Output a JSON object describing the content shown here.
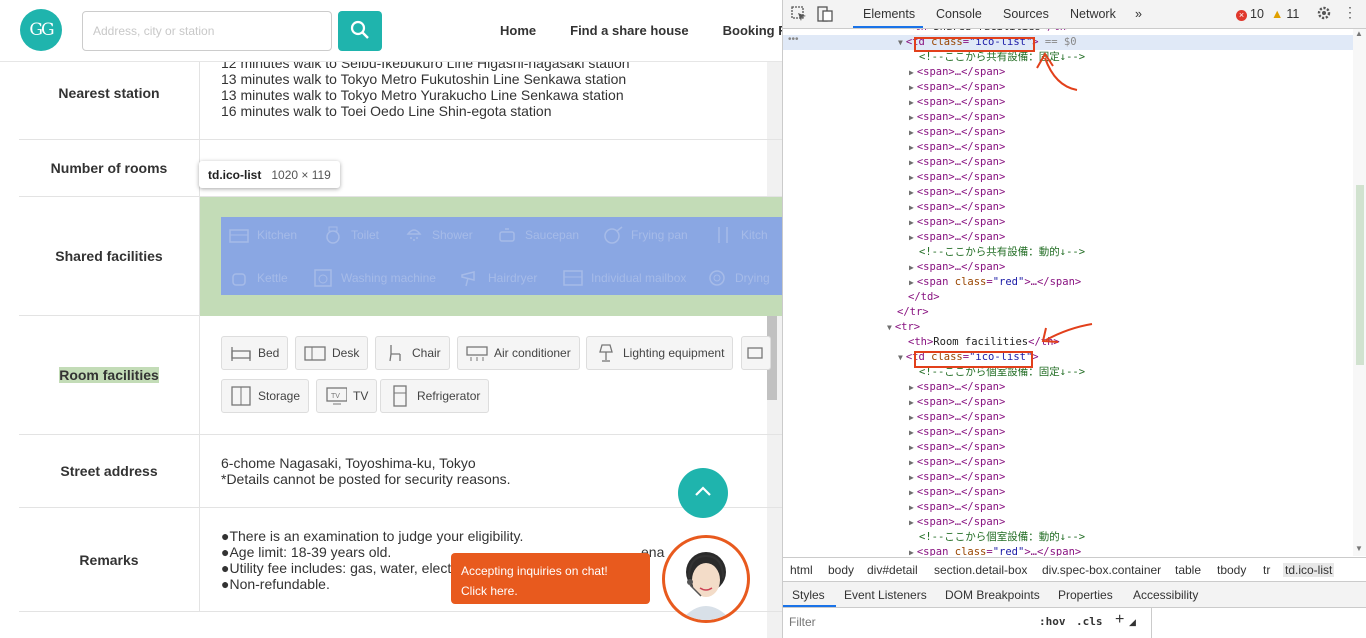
{
  "site": {
    "logo_text": "GG",
    "search_placeholder": "Address, city or station",
    "nav": [
      "Home",
      "Find a share house",
      "Booking F"
    ]
  },
  "spec": {
    "nearest_station": {
      "label": "Nearest station",
      "lines": [
        "12 minutes walk to Seibu-Ikebukuro Line Higashi-nagasaki station",
        "13 minutes walk to Tokyo Metro Fukutoshin Line Senkawa station",
        "13 minutes walk to Tokyo Metro Yurakucho Line Senkawa station",
        "16 minutes walk to Toei Oedo Line Shin-egota station"
      ]
    },
    "number_of_rooms": {
      "label": "Number of rooms"
    },
    "shared_facilities": {
      "label": "Shared facilities",
      "row1": [
        "Kitchen",
        "Toilet",
        "Shower",
        "Saucepan",
        "Frying pan",
        "Kitch"
      ],
      "row2": [
        "Kettle",
        "Washing machine",
        "Hairdryer",
        "Individual mailbox",
        "Drying"
      ]
    },
    "room_facilities": {
      "label": "Room facilities",
      "row1": [
        "Bed",
        "Desk",
        "Chair",
        "Air conditioner",
        "Lighting equipment"
      ],
      "row2": [
        "Storage",
        "TV",
        "Refrigerator"
      ]
    },
    "street_address": {
      "label": "Street address",
      "lines": [
        "6-chome Nagasaki, Toyoshima-ku, Tokyo",
        "*Details cannot be posted for security reasons."
      ]
    },
    "remarks": {
      "label": "Remarks",
      "lines": [
        "●There is an examination to judge your eligibility.",
        "●Age limit: 18-39 years old.",
        "●Utility fee includes: gas, water, elect",
        "●Non-refundable."
      ],
      "hidden_tail": "ena"
    }
  },
  "tooltip": {
    "selector": "td.ico-list",
    "size": "1020 × 119"
  },
  "chat": {
    "line1": "Accepting inquiries on chat!",
    "line2": "Click here."
  },
  "devtools": {
    "tabs": [
      "Elements",
      "Console",
      "Sources",
      "Network",
      "»"
    ],
    "errors": "10",
    "warnings": "11",
    "tree": [
      {
        "indent": 0,
        "kind": "text",
        "text": "<th>Shared facilities</th>"
      },
      {
        "indent": 0,
        "kind": "td",
        "tw": "▼",
        "tag": "td",
        "attr": "class",
        "val": "ico-list",
        "suffix": " == $0"
      },
      {
        "indent": 1,
        "kind": "comment",
        "text": "<!--ここから共有設備：固定↓-->"
      },
      {
        "indent": 1,
        "kind": "span",
        "tw": "▶"
      },
      {
        "indent": 1,
        "kind": "span",
        "tw": "▶"
      },
      {
        "indent": 1,
        "kind": "span",
        "tw": "▶"
      },
      {
        "indent": 1,
        "kind": "span",
        "tw": "▶"
      },
      {
        "indent": 1,
        "kind": "span",
        "tw": "▶"
      },
      {
        "indent": 1,
        "kind": "span",
        "tw": "▶"
      },
      {
        "indent": 1,
        "kind": "span",
        "tw": "▶"
      },
      {
        "indent": 1,
        "kind": "span",
        "tw": "▶"
      },
      {
        "indent": 1,
        "kind": "span",
        "tw": "▶"
      },
      {
        "indent": 1,
        "kind": "span",
        "tw": "▶"
      },
      {
        "indent": 1,
        "kind": "span",
        "tw": "▶"
      },
      {
        "indent": 1,
        "kind": "span",
        "tw": "▶"
      },
      {
        "indent": 1,
        "kind": "comment",
        "text": "<!--ここから共有設備：動的↓-->"
      },
      {
        "indent": 1,
        "kind": "span",
        "tw": "▶"
      },
      {
        "indent": 1,
        "kind": "spanred",
        "tw": "▶"
      },
      {
        "indent": 0,
        "kind": "close",
        "text": "</td>"
      },
      {
        "indent": -1,
        "kind": "close",
        "text": "</tr>"
      },
      {
        "indent": -1,
        "kind": "tr",
        "tw": "▼",
        "text": "<tr>"
      },
      {
        "indent": 0,
        "kind": "th",
        "text": "<th>Room facilities</th>"
      },
      {
        "indent": 0,
        "kind": "td",
        "tw": "▼",
        "tag": "td",
        "attr": "class",
        "val": "ico-list",
        "suffix": ""
      },
      {
        "indent": 1,
        "kind": "comment",
        "text": "<!--ここから個室設備：固定↓-->"
      },
      {
        "indent": 1,
        "kind": "span",
        "tw": "▶"
      },
      {
        "indent": 1,
        "kind": "span",
        "tw": "▶"
      },
      {
        "indent": 1,
        "kind": "span",
        "tw": "▶"
      },
      {
        "indent": 1,
        "kind": "span",
        "tw": "▶"
      },
      {
        "indent": 1,
        "kind": "span",
        "tw": "▶"
      },
      {
        "indent": 1,
        "kind": "span",
        "tw": "▶"
      },
      {
        "indent": 1,
        "kind": "span",
        "tw": "▶"
      },
      {
        "indent": 1,
        "kind": "span",
        "tw": "▶"
      },
      {
        "indent": 1,
        "kind": "span",
        "tw": "▶"
      },
      {
        "indent": 1,
        "kind": "span",
        "tw": "▶"
      },
      {
        "indent": 1,
        "kind": "comment",
        "text": "<!--ここから個室設備：動的↓-->"
      },
      {
        "indent": 1,
        "kind": "spanred",
        "tw": "▶"
      }
    ],
    "span_text": "<span>…</span>",
    "span_red_text": "<span class=\"red\">…</span>",
    "breadcrumbs": [
      "html",
      "body",
      "div#detail",
      "section.detail-box",
      "div.spec-box.container",
      "table",
      "tbody",
      "tr",
      "td.ico-list"
    ],
    "styles_tabs": [
      "Styles",
      "Event Listeners",
      "DOM Breakpoints",
      "Properties",
      "Accessibility"
    ],
    "filter_placeholder": "Filter",
    "hov": ":hov",
    "cls": ".cls"
  },
  "colors": {
    "brand": "#1fb4ad",
    "highlight_padding": "#c3dcb7",
    "highlight_content": "#8aa7e3",
    "chat": "#e85a1e",
    "annotation": "#e2401b"
  }
}
